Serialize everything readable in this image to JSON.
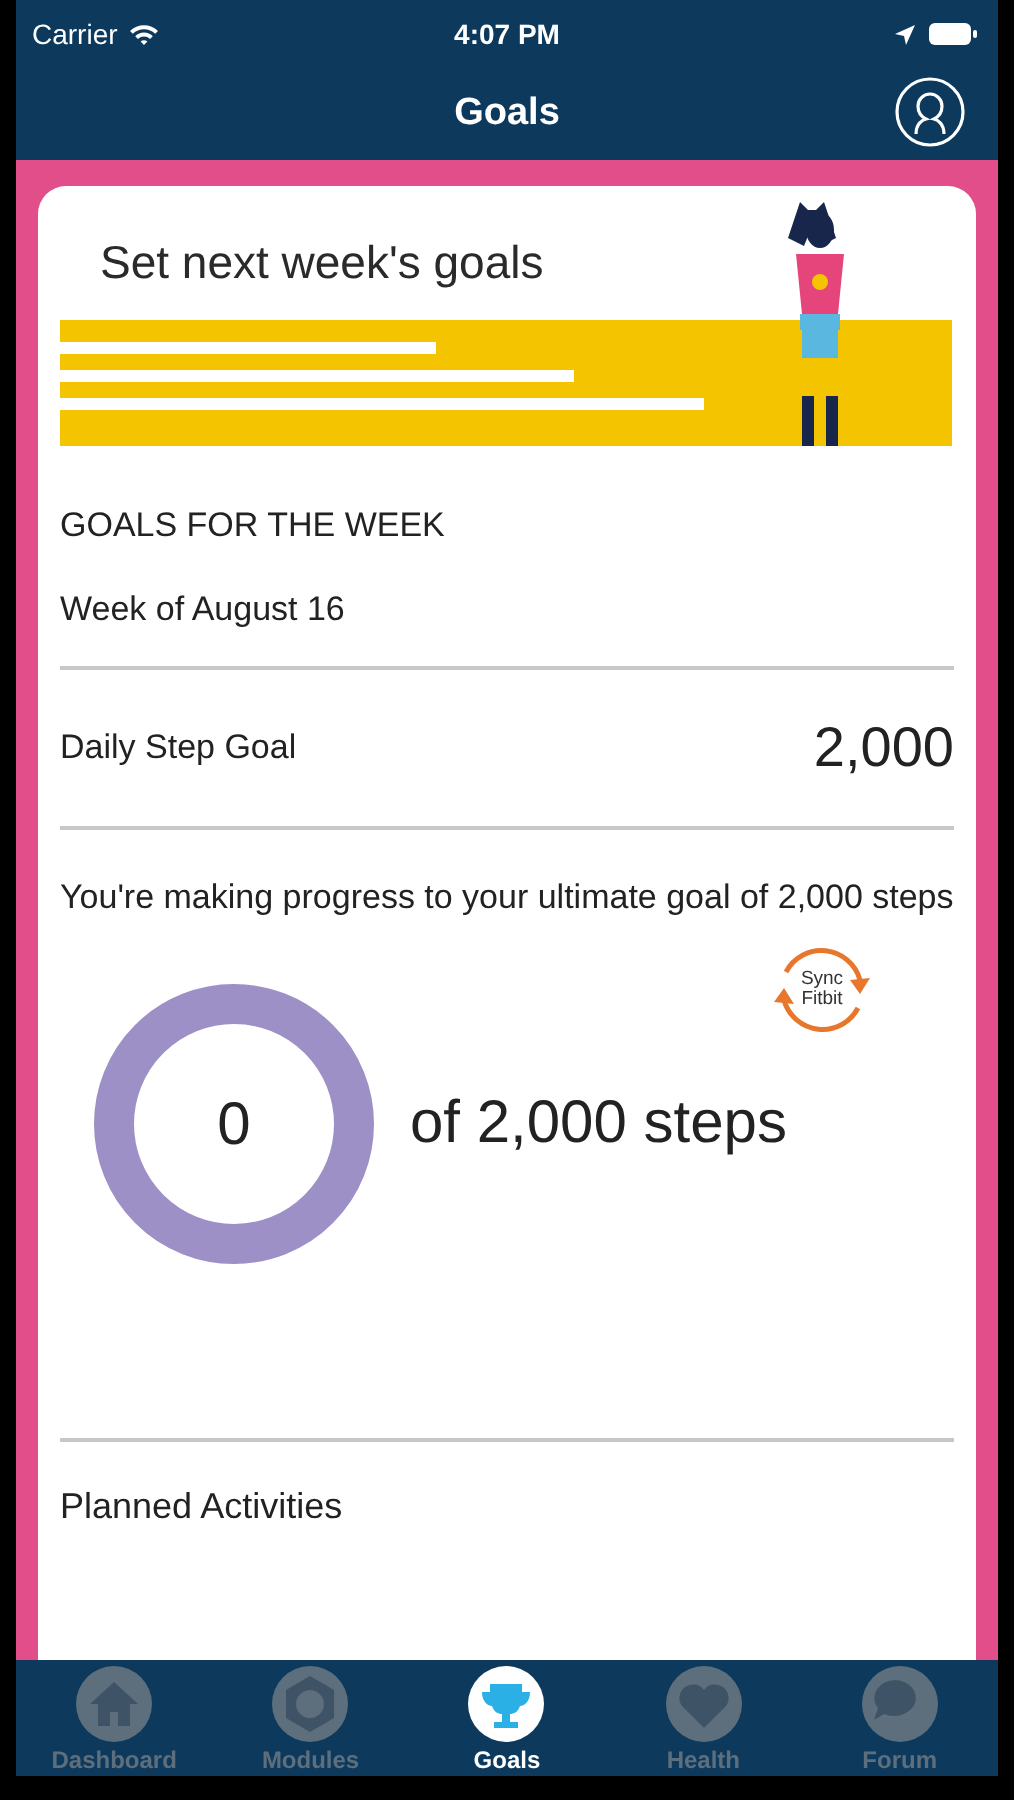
{
  "status_bar": {
    "carrier": "Carrier",
    "time": "4:07 PM"
  },
  "nav": {
    "title": "Goals"
  },
  "banner": {
    "title": "Set next week's goals"
  },
  "section": {
    "heading": "GOALS FOR THE WEEK",
    "week": "Week of August 16"
  },
  "step_goal": {
    "label": "Daily Step Goal",
    "value": "2,000"
  },
  "progress": {
    "message": "You're making progress to your ultimate goal of 2,000 steps",
    "count": "0",
    "of_text": "of 2,000 steps",
    "level": 0,
    "sync_label": "Sync Fitbit"
  },
  "planned": {
    "heading": "Planned Activities"
  },
  "tabs": [
    {
      "label": "Dashboard",
      "kind": "home",
      "selected": false
    },
    {
      "label": "Modules",
      "kind": "modules",
      "selected": false
    },
    {
      "label": "Goals",
      "kind": "trophy",
      "selected": true
    },
    {
      "label": "Health",
      "kind": "heart",
      "selected": false
    },
    {
      "label": "Forum",
      "kind": "chat",
      "selected": false
    }
  ]
}
